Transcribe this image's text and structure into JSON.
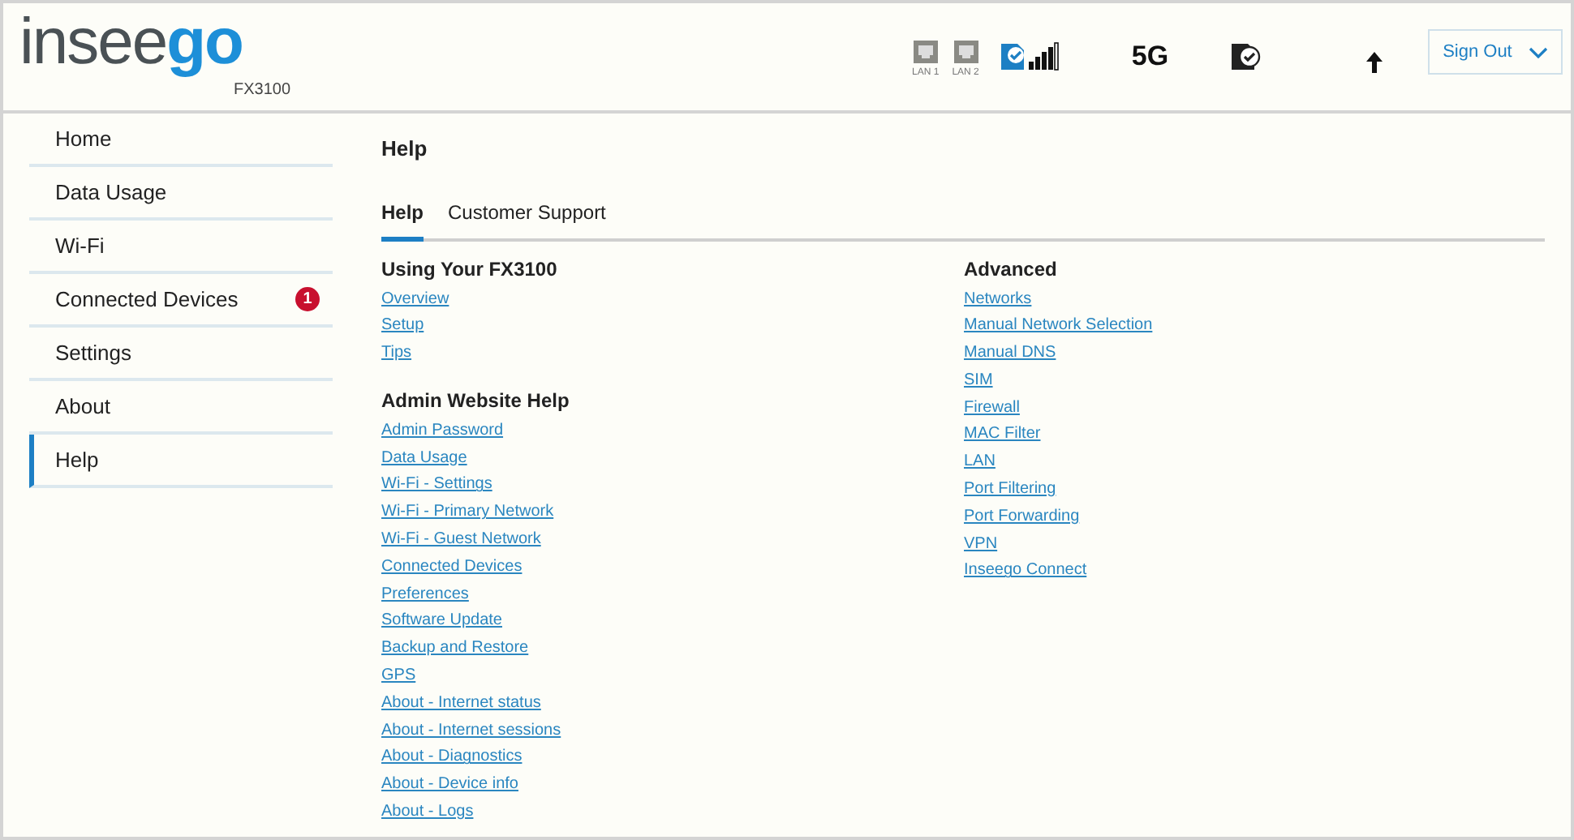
{
  "header": {
    "logo": {
      "prefix": "insee",
      "accent": "go"
    },
    "model": "FX3100",
    "lan_ports": [
      "LAN 1",
      "LAN 2"
    ],
    "network": "5G",
    "sign_out": "Sign Out"
  },
  "sidebar": {
    "items": [
      {
        "label": "Home",
        "selected": false
      },
      {
        "label": "Data Usage",
        "selected": false
      },
      {
        "label": "Wi-Fi",
        "selected": false
      },
      {
        "label": "Connected Devices",
        "selected": false,
        "badge": "1"
      },
      {
        "label": "Settings",
        "selected": false
      },
      {
        "label": "About",
        "selected": false
      },
      {
        "label": "Help",
        "selected": true
      }
    ]
  },
  "page": {
    "title": "Help",
    "tabs": [
      {
        "label": "Help",
        "selected": true
      },
      {
        "label": "Customer Support",
        "selected": false
      }
    ],
    "columns": [
      {
        "sections": [
          {
            "heading": "Using Your FX3100",
            "links": [
              "Overview",
              "Setup",
              "Tips"
            ]
          },
          {
            "heading": "Admin Website Help",
            "links": [
              "Admin Password",
              "Data Usage",
              "Wi-Fi - Settings",
              "Wi-Fi - Primary Network",
              "Wi-Fi - Guest Network",
              "Connected Devices",
              "Preferences",
              "Software Update",
              "Backup and Restore",
              "GPS",
              "About - Internet status",
              "About - Internet sessions",
              "About - Diagnostics",
              "About - Device info",
              "About - Logs"
            ]
          }
        ]
      },
      {
        "sections": [
          {
            "heading": "Advanced",
            "links": [
              "Networks",
              "Manual Network Selection",
              "Manual DNS",
              "SIM",
              "Firewall",
              "MAC Filter",
              "LAN",
              "Port Filtering",
              "Port Forwarding",
              "VPN",
              "Inseego Connect"
            ]
          }
        ]
      }
    ]
  }
}
